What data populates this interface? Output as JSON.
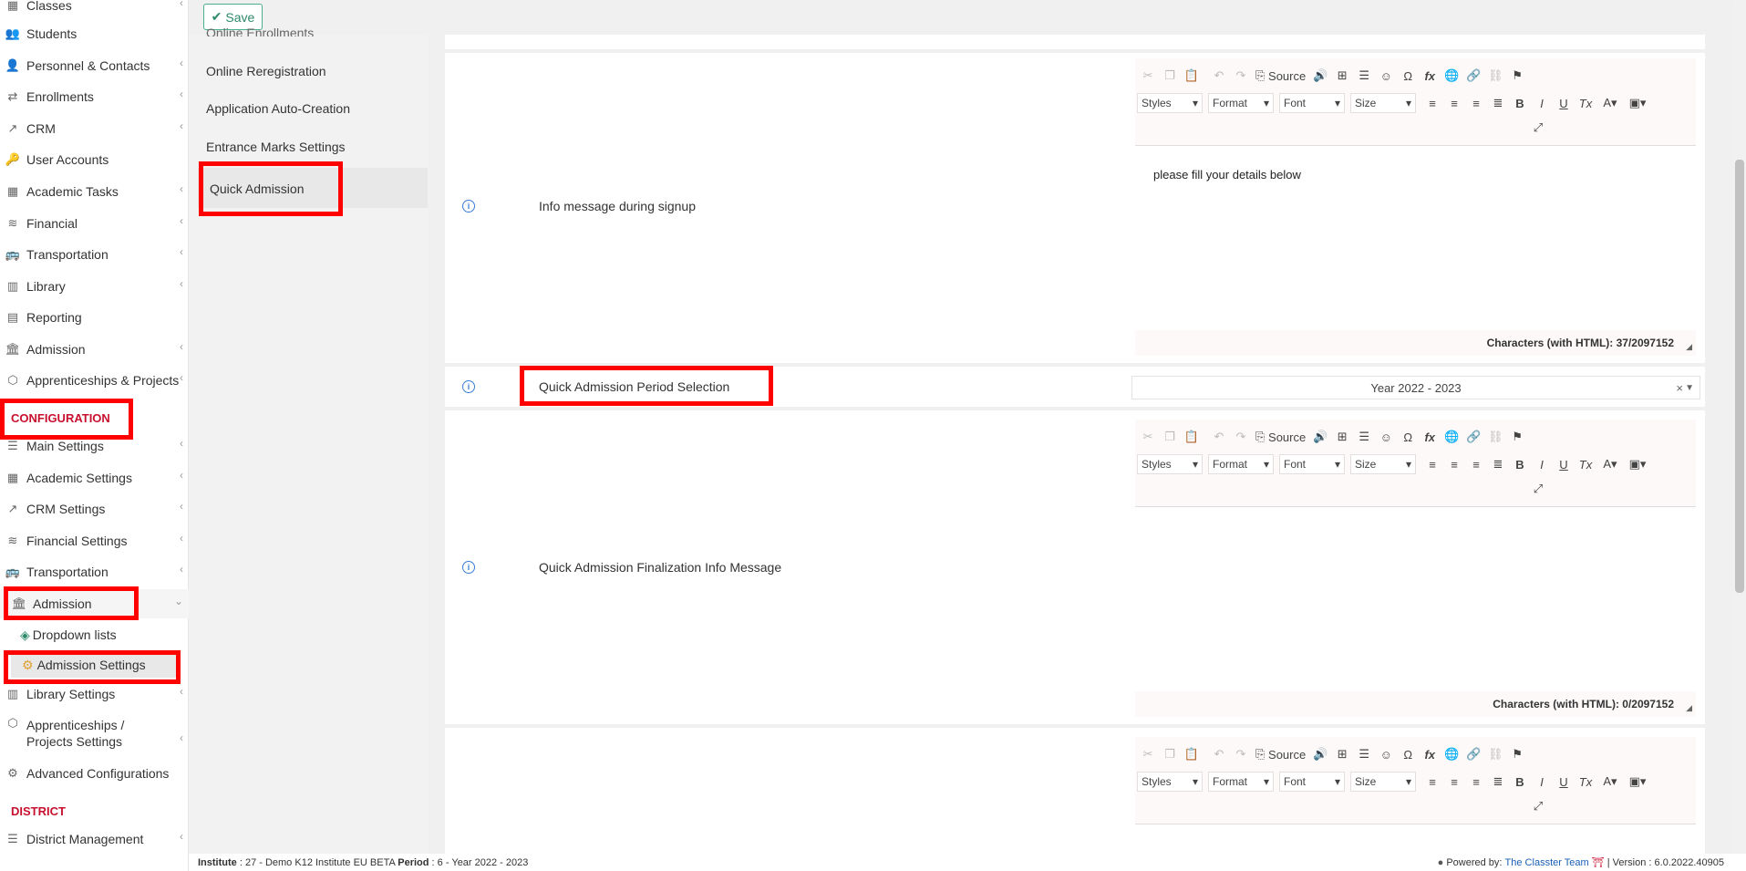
{
  "toolbar": {
    "save_label": "Save"
  },
  "sidebar": {
    "items": [
      {
        "label": "Classes",
        "icon": "classes-icon"
      },
      {
        "label": "Students",
        "icon": "students-icon"
      },
      {
        "label": "Personnel & Contacts",
        "icon": "personnel-icon"
      },
      {
        "label": "Enrollments",
        "icon": "enrollments-icon"
      },
      {
        "label": "CRM",
        "icon": "crm-icon"
      },
      {
        "label": "User Accounts",
        "icon": "key-icon"
      },
      {
        "label": "Academic Tasks",
        "icon": "grid-icon"
      },
      {
        "label": "Financial",
        "icon": "coins-icon"
      },
      {
        "label": "Transportation",
        "icon": "bus-icon"
      },
      {
        "label": "Library",
        "icon": "books-icon"
      },
      {
        "label": "Reporting",
        "icon": "printer-icon"
      },
      {
        "label": "Admission",
        "icon": "institution-icon"
      },
      {
        "label": "Apprenticeships & Projects",
        "icon": "cube-icon"
      }
    ],
    "config_heading": "CONFIGURATION",
    "config_items": [
      {
        "label": "Main Settings",
        "icon": "sliders-icon"
      },
      {
        "label": "Academic Settings",
        "icon": "classes-icon"
      },
      {
        "label": "CRM Settings",
        "icon": "crm-icon"
      },
      {
        "label": "Financial Settings",
        "icon": "coins-icon"
      },
      {
        "label": "Transportation",
        "icon": "bus-icon"
      },
      {
        "label": "Admission",
        "icon": "institution-icon"
      }
    ],
    "admission_sub": {
      "dropdown_lists": "Dropdown lists",
      "admission_settings": "Admission Settings"
    },
    "config_items_after": [
      {
        "label": "Library Settings",
        "icon": "books-icon"
      },
      {
        "label": "Apprenticeships / Projects Settings",
        "icon": "cube-icon"
      },
      {
        "label": "Advanced Configurations",
        "icon": "gears-icon"
      }
    ],
    "district_heading": "DISTRICT",
    "district_items": [
      {
        "label": "District Management",
        "icon": "list-icon"
      }
    ]
  },
  "subnav": {
    "items": [
      "Online Enrollments",
      "Online Reregistration",
      "Application Auto-Creation",
      "Entrance Marks Settings",
      "Quick Admission"
    ],
    "active": "Quick Admission"
  },
  "main": {
    "rows": [
      {
        "label": "Info message during signup",
        "editor_text": "please fill your details below",
        "char_count": "Characters (with HTML): 37/2097152"
      },
      {
        "label": "Quick Admission Period Selection",
        "select_value": "Year 2022 - 2023"
      },
      {
        "label": "Quick Admission Finalization Info Message",
        "editor_text": "",
        "char_count": "Characters (with HTML): 0/2097152"
      }
    ],
    "editor_toolbar": {
      "source_label": "Source",
      "styles": "Styles",
      "format": "Format",
      "font": "Font",
      "size": "Size"
    }
  },
  "footer": {
    "institute_label": "Institute",
    "institute_value": " : 27 - Demo K12 Institute EU BETA ",
    "period_label": "Period",
    "period_value": " : 6 - Year 2022 - 2023",
    "powered_by": "Powered by:",
    "team": "The Classter Team",
    "version": "| Version : 6.0.2022.40905"
  }
}
